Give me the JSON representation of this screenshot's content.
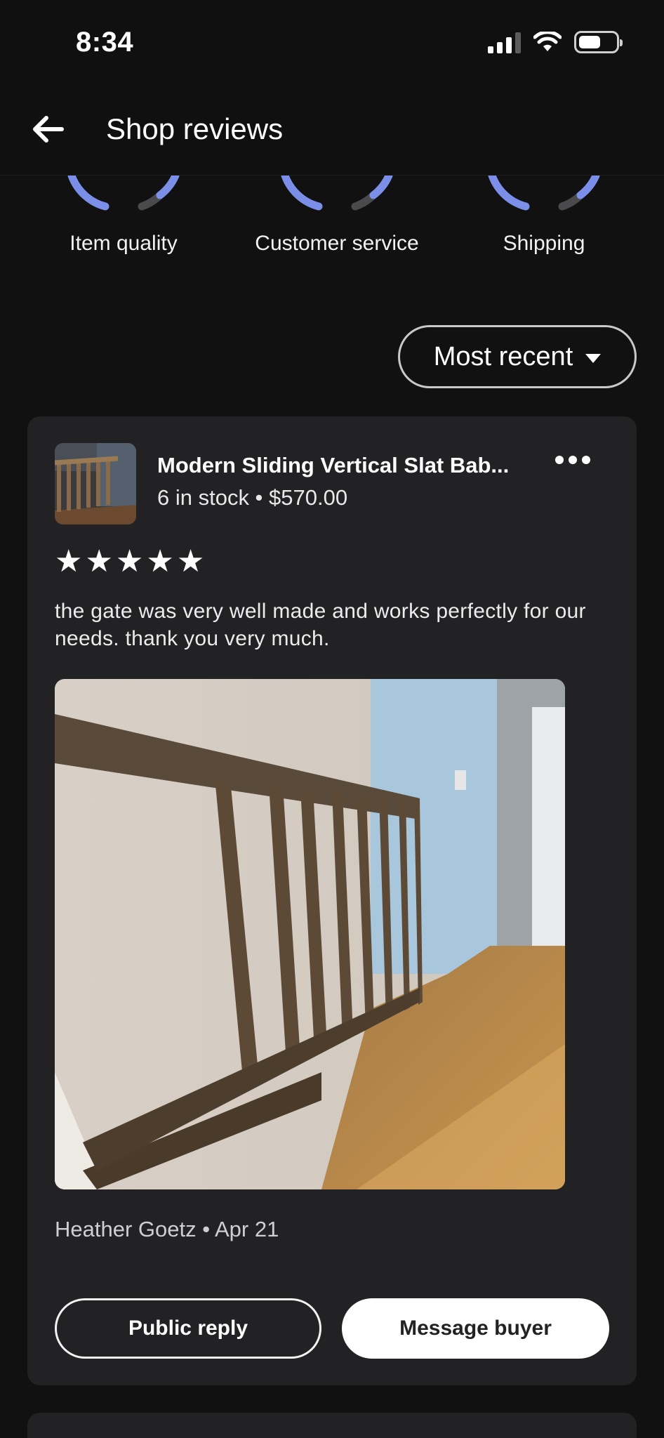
{
  "status_bar": {
    "time": "8:34"
  },
  "header": {
    "title": "Shop reviews",
    "back_icon": "arrow-left-icon"
  },
  "ratings": [
    {
      "label": "Item quality"
    },
    {
      "label": "Customer service"
    },
    {
      "label": "Shipping"
    }
  ],
  "sort": {
    "label": "Most recent",
    "icon": "caret-down-icon"
  },
  "review": {
    "product_title": "Modern Sliding Vertical Slat Bab...",
    "product_meta": "6 in stock • $570.00",
    "rating": 5,
    "stars": [
      "★",
      "★",
      "★",
      "★",
      "★"
    ],
    "text": "the gate was very well made and works perfectly for our needs. thank you very much.",
    "reviewer": "Heather Goetz • Apr 21",
    "buttons": {
      "public_reply": "Public reply",
      "message_buyer": "Message buyer"
    }
  },
  "colors": {
    "background": "#111112",
    "card": "#222224",
    "gauge_accent": "#7b8fe8",
    "gauge_track": "#4a4a4d"
  }
}
